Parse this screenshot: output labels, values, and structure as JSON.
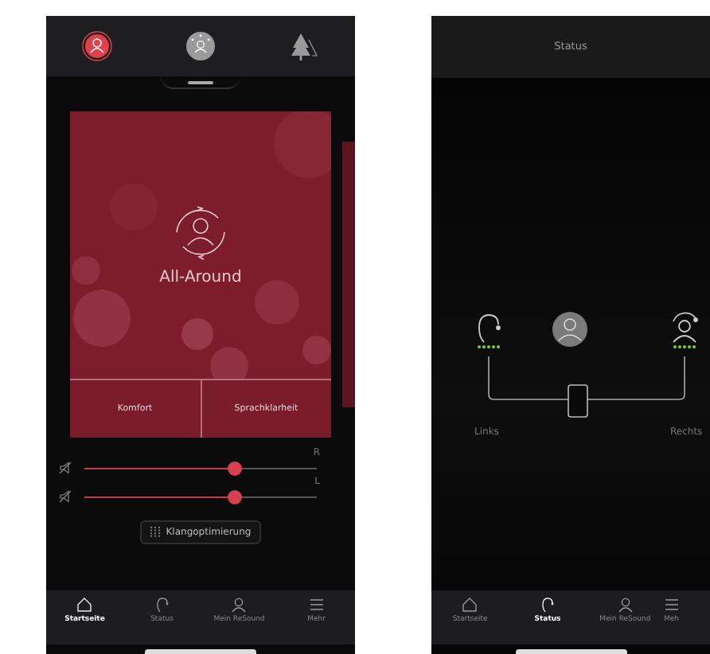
{
  "program_tabs": [
    {
      "kind": "program",
      "selected": true
    },
    {
      "kind": "ambient",
      "selected": false
    },
    {
      "kind": "outdoor",
      "selected": false
    }
  ],
  "program_card": {
    "title": "All-Around",
    "options": [
      "Komfort",
      "Sprachklarheit"
    ]
  },
  "volume": [
    {
      "side": "R",
      "level": 0.65
    },
    {
      "side": "L",
      "level": 0.65
    }
  ],
  "sound_button": "Klangoptimierung",
  "home_nav": [
    {
      "kind": "home",
      "label": "Startseite",
      "selected": true
    },
    {
      "kind": "device",
      "label": "Status",
      "selected": false
    },
    {
      "kind": "person",
      "label": "Mein ReSound",
      "selected": false
    },
    {
      "kind": "menu",
      "label": "Mehr",
      "selected": false
    }
  ],
  "status_screen": {
    "title": "Status",
    "left_label": "Links",
    "right_label": "Rechts",
    "nav": [
      {
        "kind": "home",
        "label": "Startseite",
        "selected": false
      },
      {
        "kind": "device",
        "label": "Status",
        "selected": true
      },
      {
        "kind": "person",
        "label": "Mein ReSound",
        "selected": false
      },
      {
        "kind": "menu",
        "label": "Meh",
        "selected": false
      }
    ]
  }
}
